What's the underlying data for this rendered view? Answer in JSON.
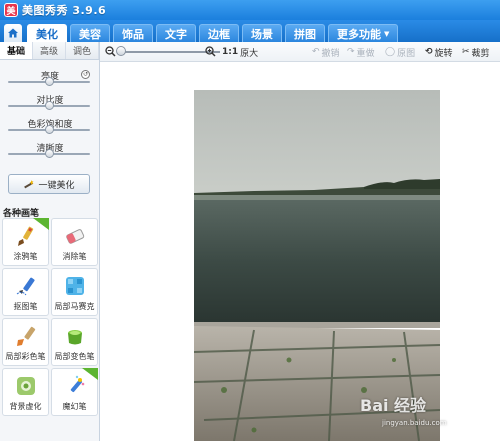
{
  "app": {
    "title": "美图秀秀 3.9.6",
    "logo_text": "美"
  },
  "nav": {
    "tabs": [
      {
        "label": "美化"
      },
      {
        "label": "美容"
      },
      {
        "label": "饰品"
      },
      {
        "label": "文字"
      },
      {
        "label": "边框"
      },
      {
        "label": "场景"
      },
      {
        "label": "拼图"
      },
      {
        "label": "更多功能"
      }
    ],
    "active": "美化"
  },
  "left_panel": {
    "subtabs": [
      {
        "label": "基础"
      },
      {
        "label": "高级"
      },
      {
        "label": "调色"
      }
    ],
    "sliders": [
      {
        "label": "亮度",
        "level": 0.5
      },
      {
        "label": "对比度",
        "level": 0.5
      },
      {
        "label": "色彩饱和度",
        "level": 0.5
      },
      {
        "label": "清晰度",
        "level": 0.5
      }
    ],
    "one_key_label": "一键美化",
    "brush_section_title": "各种画笔",
    "brushes": [
      {
        "label": "涂鸦笔",
        "icon": "brush-icon",
        "badge": "new-badge"
      },
      {
        "label": "消除笔",
        "icon": "eraser-icon"
      },
      {
        "label": "抠图笔",
        "icon": "cutout-pen-icon"
      },
      {
        "label": "局部马赛克",
        "icon": "mosaic-icon"
      },
      {
        "label": "局部彩色笔",
        "icon": "color-brush-icon"
      },
      {
        "label": "局部变色笔",
        "icon": "paint-bucket-icon"
      },
      {
        "label": "背景虚化",
        "icon": "blur-icon"
      },
      {
        "label": "魔幻笔",
        "icon": "magic-pen-icon",
        "badge": "new-badge"
      }
    ]
  },
  "toolbar": {
    "zoom_ratio": "1:1",
    "original_size": "原大",
    "undo": "撤销",
    "redo": "重做",
    "original": "原图",
    "rotate": "旋转",
    "crop": "裁剪"
  },
  "watermark": {
    "text": "Bai 经验",
    "sub": "jingyan.baidu.com"
  },
  "colors": {
    "accent": "#1b7fdd",
    "panel_bg": "#f4f6f9",
    "photo_water": "#2f3b38"
  }
}
